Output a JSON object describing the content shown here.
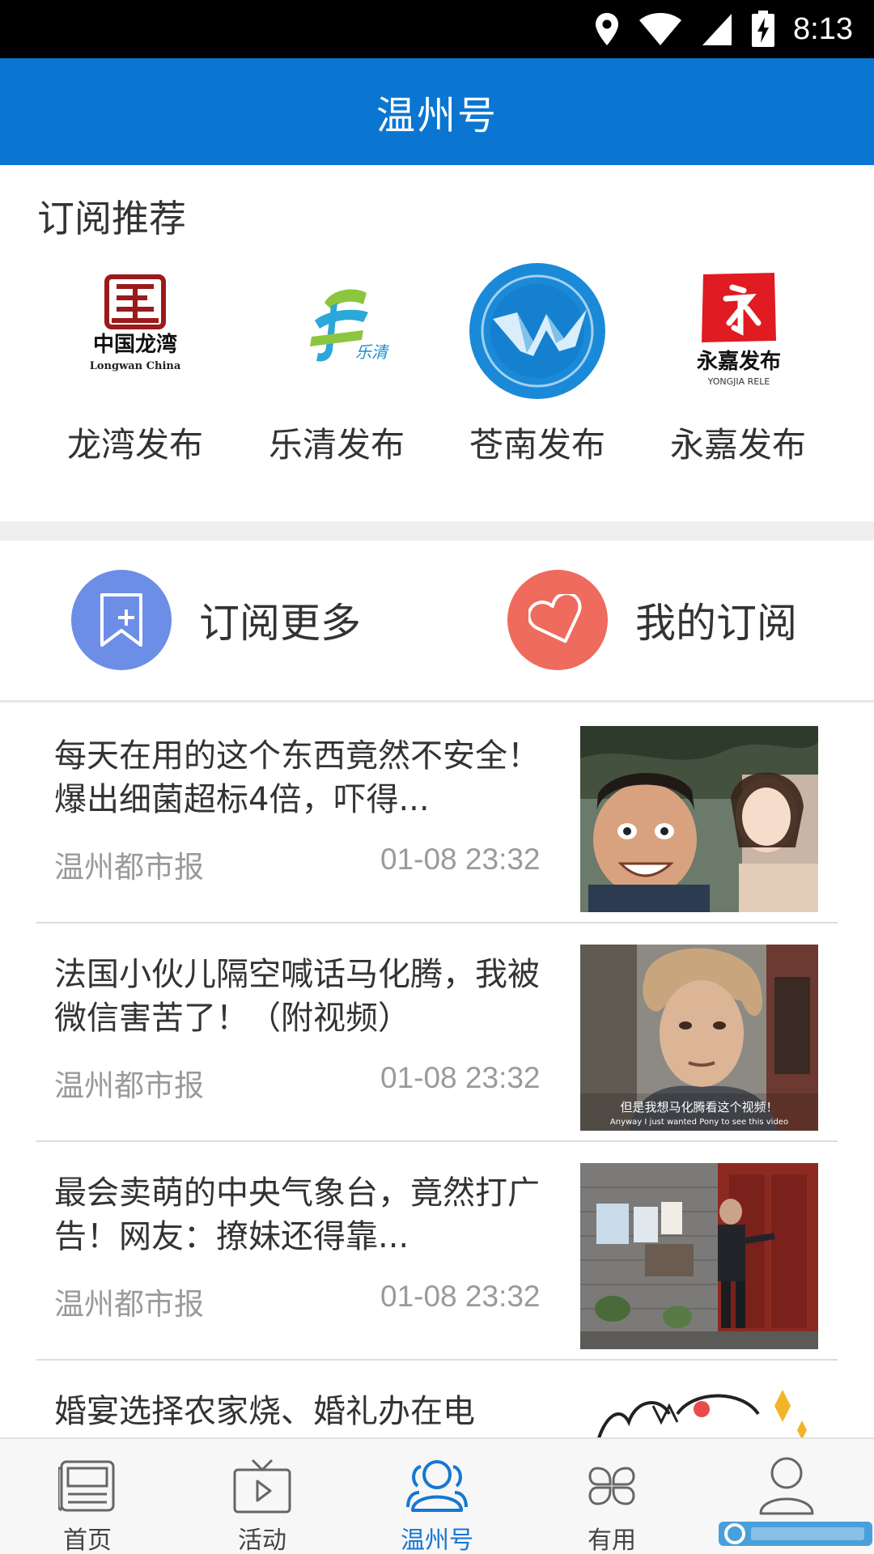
{
  "status_bar": {
    "time": "8:13",
    "icons": [
      "location-icon",
      "wifi-icon",
      "signal-icon",
      "battery-charging-icon"
    ]
  },
  "app_bar": {
    "title": "温州号"
  },
  "recommend": {
    "title": "订阅推荐",
    "items": [
      {
        "label": "龙湾发布",
        "logo_text": "中国龙湾",
        "logo_sub": "Longwan China",
        "icon": "longwan-logo"
      },
      {
        "label": "乐清发布",
        "logo_text": "乐清",
        "icon": "yueqing-logo"
      },
      {
        "label": "苍南发布",
        "icon": "cangnan-logo"
      },
      {
        "label": "永嘉发布",
        "logo_text": "永嘉发布",
        "logo_sub": "YONGJIA RELE",
        "icon": "yongjia-logo"
      }
    ]
  },
  "actions": {
    "subscribe_more": {
      "label": "订阅更多",
      "color": "#6d8ee6",
      "icon": "bookmark-add-icon"
    },
    "my_subscriptions": {
      "label": "我的订阅",
      "color": "#ee6b5e",
      "icon": "heart-icon"
    }
  },
  "news": [
    {
      "title": "每天在用的这个东西竟然不安全！爆出细菌超标4倍，吓得...",
      "source": "温州都市报",
      "time": "01-08 23:32"
    },
    {
      "title": "法国小伙儿隔空喊话马化腾，我被微信害苦了！（附视频）",
      "source": "温州都市报",
      "time": "01-08 23:32",
      "caption_cn": "但是我想马化腾看这个视频！",
      "caption_en": "Anyway I just wanted Pony to see this video"
    },
    {
      "title": "最会卖萌的中央气象台，竟然打广告！网友：撩妹还得靠...",
      "source": "温州都市报",
      "time": "01-08 23:32"
    },
    {
      "title": "婚宴选择农家烧、婚礼办在电",
      "source": "",
      "time": ""
    }
  ],
  "bottom_nav": [
    {
      "label": "首页",
      "icon": "newspaper-icon",
      "active": false
    },
    {
      "label": "活动",
      "icon": "tv-icon",
      "active": false
    },
    {
      "label": "温州号",
      "icon": "people-icon",
      "active": true
    },
    {
      "label": "有用",
      "icon": "grid-icon",
      "active": false
    },
    {
      "label": "",
      "icon": "person-icon",
      "active": false
    }
  ],
  "colors": {
    "primary": "#0a76d1",
    "active_tab": "#1677d2"
  }
}
